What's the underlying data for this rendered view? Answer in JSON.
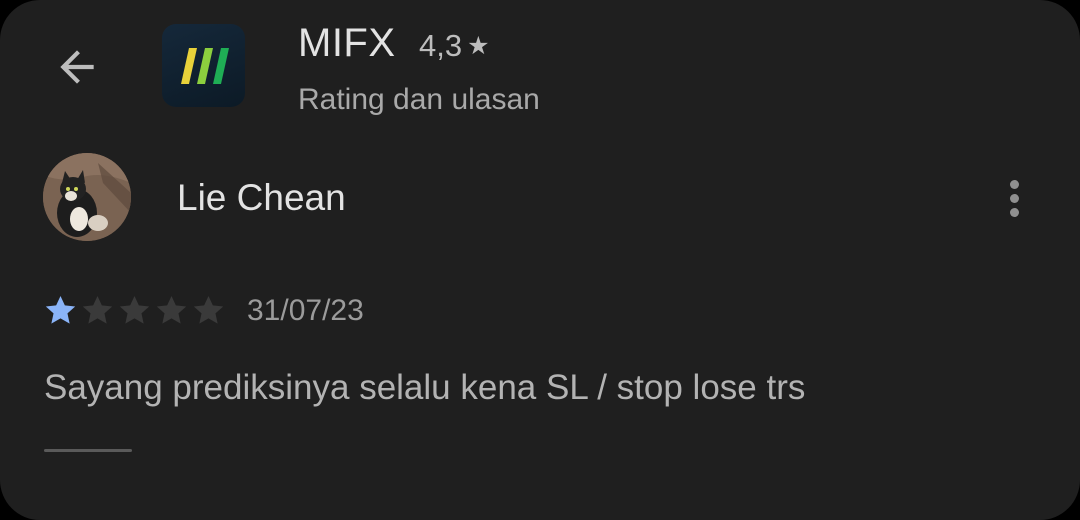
{
  "app": {
    "name": "MIFX",
    "rating": "4,3",
    "subtitle": "Rating dan ulasan",
    "icon": "mifx-logo-icon"
  },
  "review": {
    "author": "Lie Chean",
    "stars": 1,
    "max_stars": 5,
    "date": "31/07/23",
    "text": "Sayang prediksinya selalu kena SL / stop lose trs"
  },
  "icons": {
    "back": "back-arrow-icon",
    "more": "more-vert-icon",
    "rating_star": "star-icon"
  },
  "colors": {
    "background": "#1f1f1f",
    "star_filled": "#8ab4f8",
    "star_empty": "#3a3a3a",
    "text_primary": "#e3e3e3",
    "text_secondary": "#a9a9a9"
  }
}
